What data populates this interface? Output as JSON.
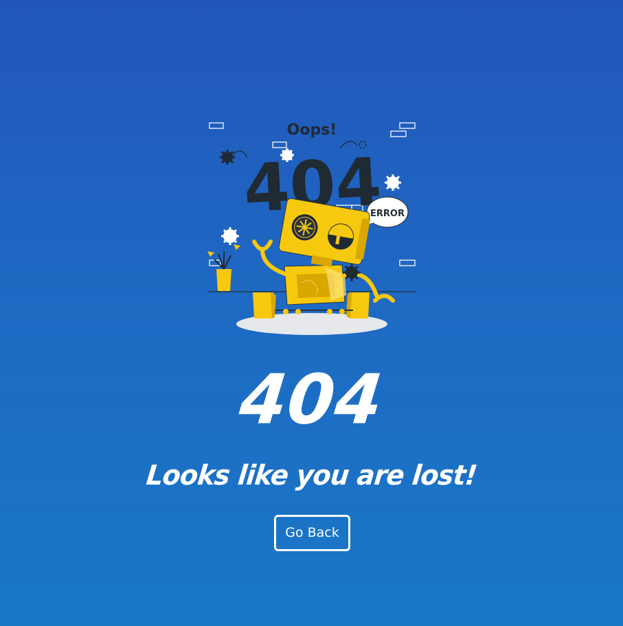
{
  "illustration": {
    "oops_text": "Oops!",
    "error_code_text": "404",
    "error_bubble_text": "ERROR",
    "colors": {
      "dark": "#1f2a33",
      "yellow": "#f6c90e",
      "yellow_dark": "#d9a700",
      "outline": "#2a3440",
      "platform": "#e6e8ec",
      "white": "#ffffff"
    }
  },
  "heading": {
    "code": "404",
    "message": "Looks like you are lost!"
  },
  "actions": {
    "go_back_label": "Go Back"
  }
}
